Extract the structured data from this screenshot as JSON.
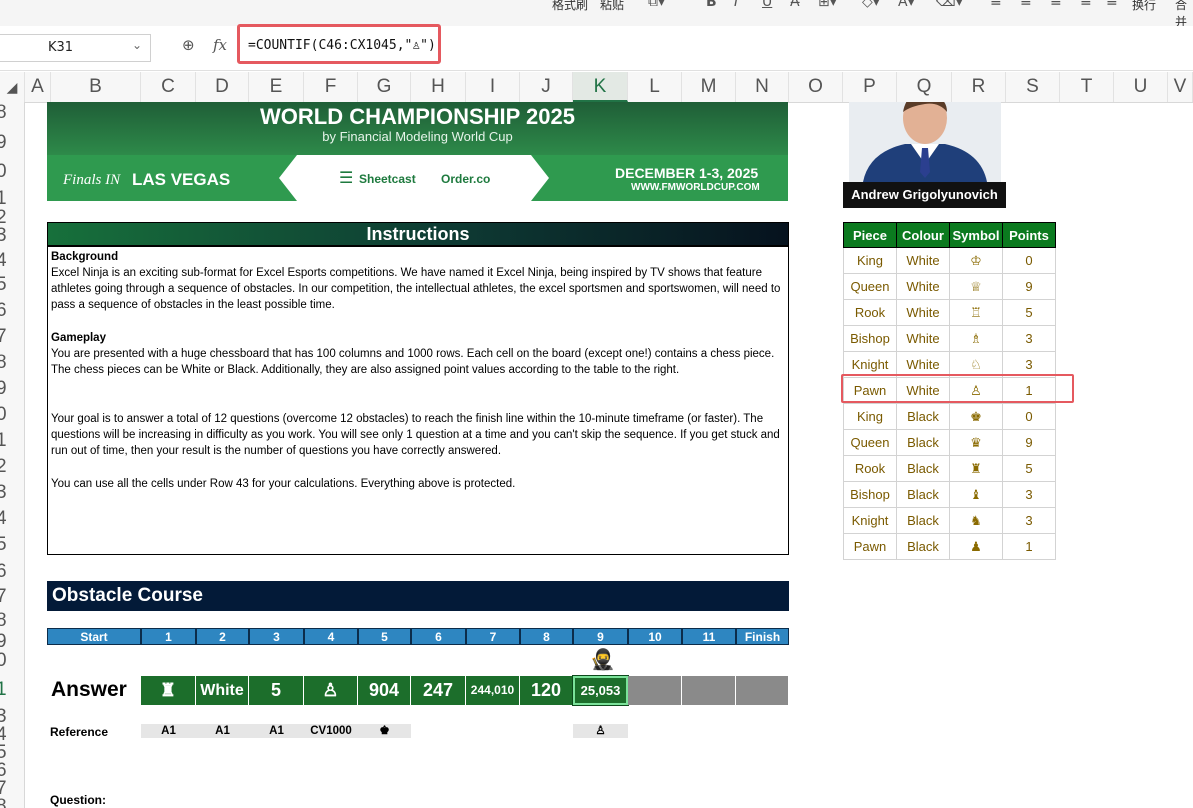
{
  "ribbon": {
    "format_painter": "格式刷",
    "paste": "粘贴",
    "wrap": "换行",
    "merge": "合并"
  },
  "formula_bar": {
    "cell_ref": "K31",
    "fx": "fx",
    "formula": "=COUNTIF(C46:CX1045,\"♙\")"
  },
  "columns": [
    "A",
    "B",
    "C",
    "D",
    "E",
    "F",
    "G",
    "H",
    "I",
    "J",
    "K",
    "L",
    "M",
    "N",
    "O",
    "P",
    "Q",
    "R",
    "S",
    "T",
    "U",
    "V"
  ],
  "selected_column": "K",
  "rows": [
    "8",
    "9",
    "0",
    "1",
    "2",
    "3",
    "4",
    "5",
    "6",
    "7",
    "8",
    "9",
    "0",
    "1",
    "2",
    "3",
    "4",
    "5",
    "6",
    "7",
    "8",
    "9",
    "0",
    "1",
    "3",
    "4",
    "5",
    "6",
    "7",
    "8"
  ],
  "banner": {
    "title": "WORLD CHAMPIONSHIP 2025",
    "subtitle": "by Financial Modeling World Cup",
    "finals": "Finals IN",
    "city": "LAS VEGAS",
    "sponsor1": "Sheetcast",
    "sponsor2": "Order.co",
    "dates": "DECEMBER 1-3, 2025",
    "url": "WWW.FMWORLDCUP.COM"
  },
  "player_name": "Andrew Grigolyunovich",
  "instructions": {
    "title": "Instructions",
    "background_heading": "Background",
    "background_text": "Excel Ninja is an exciting sub-format for Excel Esports competitions. We have named it Excel Ninja, being inspired by TV shows that feature athletes going through a sequence of obstacles. In our competition, the intellectual athletes, the excel sportsmen and sportswomen, will need to pass a sequence of obstacles in the least possible time.",
    "gameplay_heading": "Gameplay",
    "gameplay_text": "You are presented with a huge chessboard that has 100 columns and 1000 rows. Each cell on the board (except one!) contains a chess piece. The chess pieces can be White or Black. Additionally, they are also assigned point values according to the table to the right.",
    "goal_text": "Your goal is to answer a total of 12 questions (overcome 12 obstacles) to reach the finish line within the 10-minute timeframe (or faster). The questions will be increasing in difficulty as you work. You will see only 1 question at a time and you can't skip the sequence. If you get stuck and run out of time, then your result is the number of questions you have correctly answered.",
    "cells_text": "You can use all the cells under Row 43 for your calculations. Everything above is protected."
  },
  "legend": {
    "headers": [
      "Piece",
      "Colour",
      "Symbol",
      "Points"
    ],
    "rows": [
      [
        "King",
        "White",
        "♔",
        "0"
      ],
      [
        "Queen",
        "White",
        "♕",
        "9"
      ],
      [
        "Rook",
        "White",
        "♖",
        "5"
      ],
      [
        "Bishop",
        "White",
        "♗",
        "3"
      ],
      [
        "Knight",
        "White",
        "♘",
        "3"
      ],
      [
        "Pawn",
        "White",
        "♙",
        "1"
      ],
      [
        "King",
        "Black",
        "♚",
        "0"
      ],
      [
        "Queen",
        "Black",
        "♛",
        "9"
      ],
      [
        "Rook",
        "Black",
        "♜",
        "5"
      ],
      [
        "Bishop",
        "Black",
        "♝",
        "3"
      ],
      [
        "Knight",
        "Black",
        "♞",
        "3"
      ],
      [
        "Pawn",
        "Black",
        "♟",
        "1"
      ]
    ]
  },
  "obstacle_course": {
    "title": "Obstacle Course",
    "steps": [
      "Start",
      "1",
      "2",
      "3",
      "4",
      "5",
      "6",
      "7",
      "8",
      "9",
      "10",
      "11",
      "Finish"
    ],
    "answer_label": "Answer",
    "answers": [
      "♜",
      "White",
      "5",
      "♙",
      "904",
      "247",
      "244,010",
      "120",
      "25,053",
      "",
      "",
      ""
    ],
    "reference_label": "Reference",
    "references": [
      "A1",
      "A1",
      "A1",
      "CV1000",
      "♚",
      "",
      "",
      "",
      "♙",
      "",
      "",
      ""
    ],
    "question_label": "Question:"
  },
  "colors": {
    "accent_green": "#1c6e2b",
    "step_blue": "#2e86c1",
    "highlight_red": "#e5595f"
  }
}
